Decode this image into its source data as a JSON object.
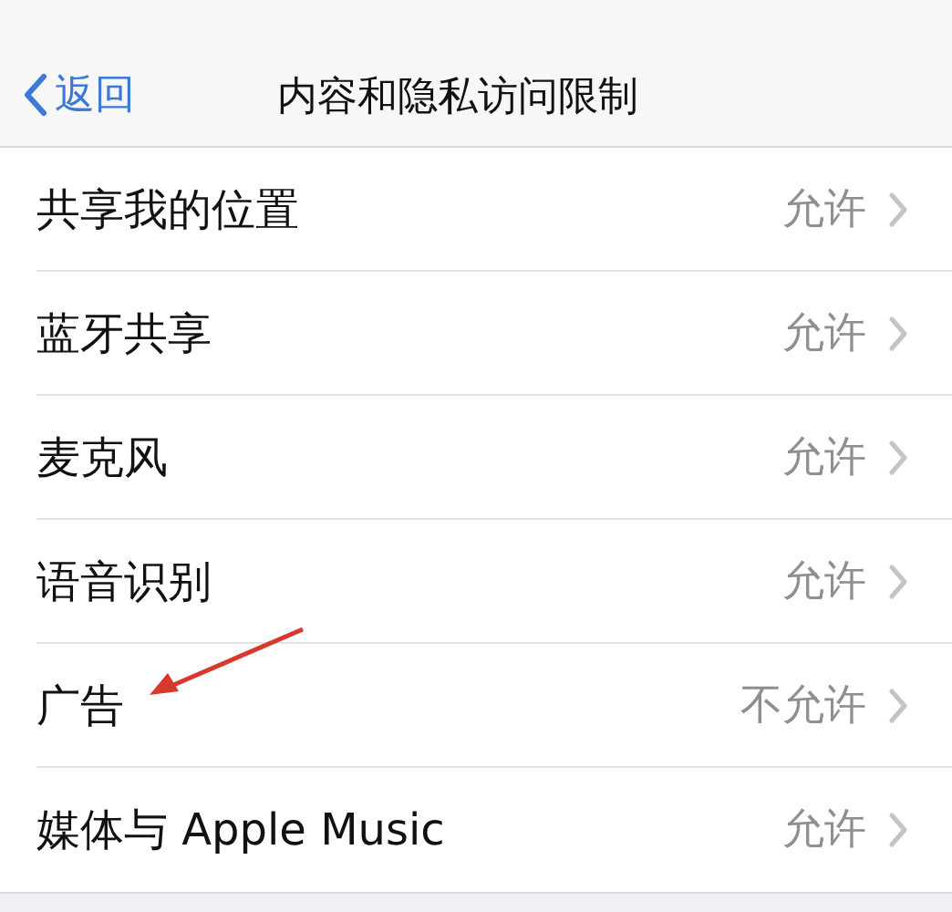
{
  "nav_bar": {
    "back_label": "返回",
    "title": "内容和隐私访问限制"
  },
  "rows": [
    {
      "label": "共享我的位置",
      "value": "允许",
      "marked": false
    },
    {
      "label": "蓝牙共享",
      "value": "允许",
      "marked": false
    },
    {
      "label": "麦克风",
      "value": "允许",
      "marked": false
    },
    {
      "label": "语音识别",
      "value": "允许",
      "marked": false
    },
    {
      "label": "广告",
      "value": "不允许",
      "marked": true
    },
    {
      "label": "媒体与 Apple Music",
      "value": "允许",
      "marked": false
    }
  ]
}
